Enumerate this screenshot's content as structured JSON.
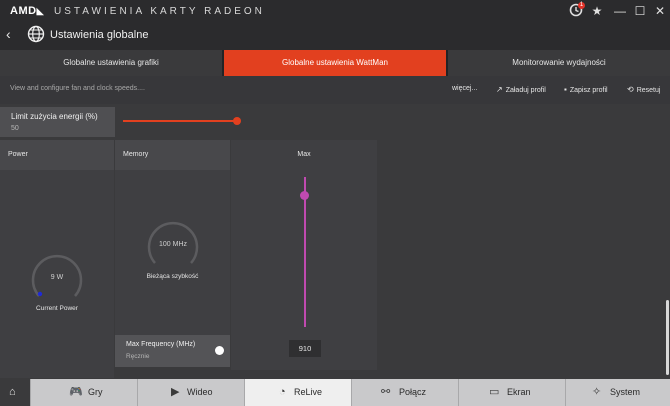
{
  "titlebar": {
    "brand": "AMD",
    "brand_arrow": "◣",
    "title": "USTAWIENIA KARTY RADEON",
    "notification_count": "1",
    "icons": {
      "notifications": "notification-icon",
      "favorite": "star-icon",
      "minimize": "minimize-icon",
      "maximize": "maximize-icon",
      "close": "close-icon"
    }
  },
  "header": {
    "back_glyph": "‹",
    "title": "Ustawienia globalne"
  },
  "tabs": [
    {
      "label": "Globalne ustawienia grafiki",
      "active": false
    },
    {
      "label": "Globalne ustawienia WattMan",
      "active": true
    },
    {
      "label": "Monitorowanie wydajności",
      "active": false
    }
  ],
  "toolbar": {
    "description": "View and configure fan and clock speeds....",
    "more_label": "więcej...",
    "load_label": "Załaduj profil",
    "save_label": "Zapisz profil",
    "reset_label": "Resetuj"
  },
  "power_limit": {
    "label": "Limit zużycia energii (%)",
    "value": "50",
    "slider_fraction": 0.5
  },
  "power_panel": {
    "header": "Power",
    "gauge_value": "9 W",
    "gauge_label": "Current Power"
  },
  "memory_panel": {
    "header": "Memory",
    "gauge_value": "100 MHz",
    "gauge_label": "Bieżąca szybkość",
    "max_freq_label": "Max Frequency (MHz)",
    "max_freq_mode": "Ręcznie"
  },
  "max_panel": {
    "header": "Max",
    "value": "910"
  },
  "bottom_nav": [
    {
      "label": "",
      "icon": "home-icon"
    },
    {
      "label": "Gry",
      "icon": "gamepad-icon"
    },
    {
      "label": "Wideo",
      "icon": "play-icon"
    },
    {
      "label": "ReLive",
      "icon": "relive-icon"
    },
    {
      "label": "Połącz",
      "icon": "connect-icon"
    },
    {
      "label": "Ekran",
      "icon": "display-icon"
    },
    {
      "label": "System",
      "icon": "system-icon"
    }
  ],
  "colors": {
    "accent": "#e2401f",
    "memory_slider": "#c04ab0",
    "power_dot": "#1f2ad8"
  }
}
